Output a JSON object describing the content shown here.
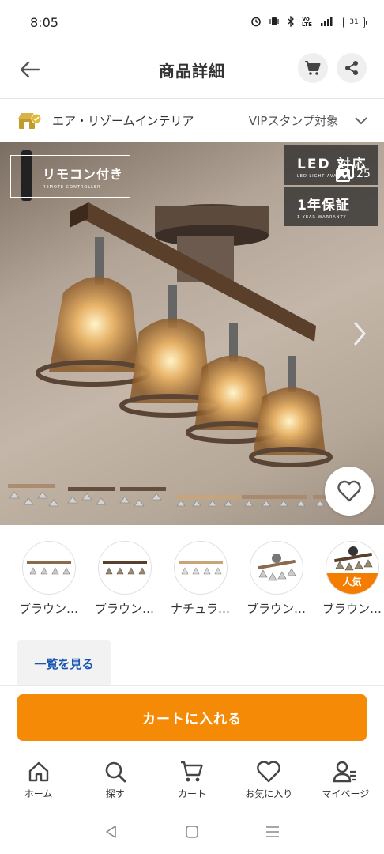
{
  "status_bar": {
    "time": "8:05",
    "battery": "31",
    "signal_text": "Vo LTE"
  },
  "header": {
    "title": "商品詳細"
  },
  "shop": {
    "name": "エア・リゾームインテリア",
    "vip_label": "VIPスタンプ対象"
  },
  "product_image": {
    "remote_badge": {
      "main": "リモコン付き",
      "sub": "REMOTE CONTROLLER"
    },
    "led_badge": {
      "main": "LED 対応",
      "sub": "LED LIGHT AVAILABLE"
    },
    "warranty_badge": {
      "main": "1年保証",
      "sub": "1 YEAR WARRANTY"
    },
    "gallery_count": "25"
  },
  "variants": [
    {
      "label": "ブラウン…",
      "popular": false
    },
    {
      "label": "ブラウン…",
      "popular": false
    },
    {
      "label": "ナチュラ…",
      "popular": false
    },
    {
      "label": "ブラウン…",
      "popular": false
    },
    {
      "label": "ブラウン…",
      "popular": true,
      "popular_label": "人気"
    }
  ],
  "see_all_label": "一覧を見る",
  "cart_cta_label": "カートに入れる",
  "bottom_nav": [
    {
      "label": "ホーム",
      "icon": "home-icon"
    },
    {
      "label": "探す",
      "icon": "search-icon"
    },
    {
      "label": "カート",
      "icon": "cart-icon"
    },
    {
      "label": "お気に入り",
      "icon": "heart-icon"
    },
    {
      "label": "マイページ",
      "icon": "person-icon"
    }
  ],
  "colors": {
    "accent": "#f58a07",
    "popular": "#f47d00",
    "link": "#1a56b0"
  }
}
